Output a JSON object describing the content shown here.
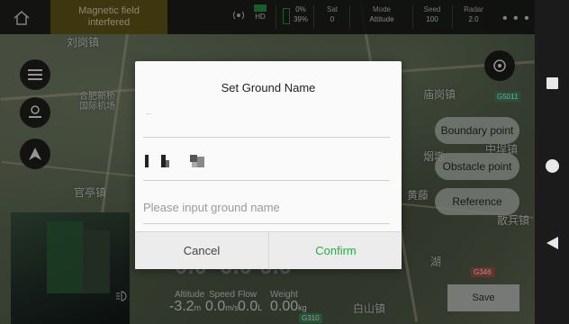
{
  "status_bar": {
    "warning": "Magnetic field interfered",
    "warning_line1": "Magnetic field",
    "warning_line2": "interfered",
    "rc_signal": "HD",
    "battery_percent": "39%",
    "battery_top": "0%",
    "sat_label": "Sat",
    "sat_value": "0",
    "mode_label": "Mode",
    "mode_value": "Attitude",
    "seed_label": "Seed",
    "seed_value": "100",
    "radar_label": "Radar",
    "radar_value": "2.0",
    "more": "• • •"
  },
  "map": {
    "labels": [
      "刘岗镇",
      "合肥新桥\n国际机场",
      "庙岗镇",
      "官亭镇",
      "黄藤",
      "散兵镇",
      "湖",
      "白山镇",
      "中垾镇",
      "烟墩"
    ],
    "road_tags": [
      "G5011",
      "G346",
      "G310"
    ]
  },
  "right_pills": {
    "boundary": "Boundary point",
    "obstacle": "Obstacle point",
    "reference": "Reference"
  },
  "telemetry": {
    "ghost_values": [
      "0.0",
      "0.0",
      "0.0"
    ],
    "labels": [
      "Altitude",
      "Speed",
      "Flow",
      "Weight"
    ],
    "values": [
      "-3.2",
      "0.0",
      "0.0",
      "0.00"
    ],
    "units": [
      "m",
      "m/s",
      "L",
      "kg"
    ]
  },
  "save_label": "Save",
  "dialog": {
    "title": "Set Ground Name",
    "placeholder": "Please input ground name",
    "cancel": "Cancel",
    "confirm": "Confirm"
  },
  "colors": {
    "confirm": "#2ea84c",
    "warning_bg": "#6a5e1b",
    "topbar": "#141614"
  }
}
